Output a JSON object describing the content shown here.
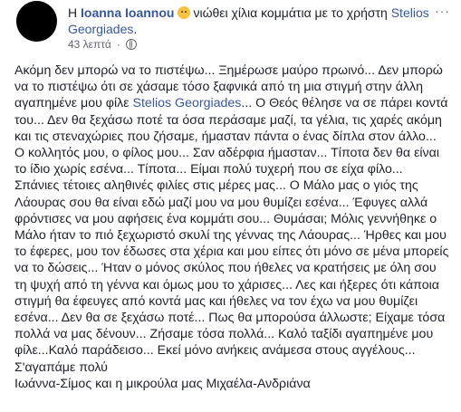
{
  "post": {
    "author": "Ioanna Ioannou",
    "prefix": "Η",
    "feeling_icon": "sad-face-emoji",
    "feeling_text": "νιώθει χίλια κομμάτια με το χρήστη",
    "tagged_user": "Stelios Georgiades",
    "tagged_suffix": ".",
    "time": "43 λεπτά",
    "separator": "·",
    "privacy_icon": "globe-icon",
    "more_label": "···",
    "body_part1": "Ακόμη δεν μπορώ να το πιστέψω... Ξημέρωσε μαύρο πρωινό... Δεν μπορώ να το πιστέψω ότι σε χάσαμε τόσο ξαφνικά από τη μια στιγμή στην άλλη αγαπημένε μου φίλε",
    "body_mention": "Stelios Georgiades",
    "body_part2": "... Ο Θεός θέλησε να σε πάρει κοντά του... Δεν θα ξεχάσω ποτέ τα όσα περάσαμε μαζί, τα γέλια, τις χαρές ακόμη και τις στεναχώριες που ζήσαμε, ήμασταν πάντα ο ένας δίπλα στον άλλο... Ο κολλητός μου, ο φίλος μου... Σαν αδέρφια ήμασταν... Τίποτα δεν θα είναι το ίδιο χωρίς εσένα... Τίποτα... Είμαι πολύ τυχερή που σε είχα φίλο... Σπάνιες τέτοιες αληθινές φιλίες στις μέρες μας... Ο Μάλο μας ο γιός της Λάουρας σου θα είναι εδώ μαζί μου να μου θυμίζει εσένα... Έφυγες αλλά φρόντισες να μου αφήσεις ένα κομμάτι σου... Θυμάσαι; Μόλις γεννήθηκε ο Μάλο ήταν το πιό ξεχωριστό σκυλί της γέννας της Λάουρας... Ήρθες και μου το έφερες, μου τον έδωσες στα χέρια και μου είπες ότι μόνο σε μένα μπορείς να το δώσεις... Ήταν ο μόνος σκύλος που ήθελες να κρατήσεις με όλη σου τη ψυχή από τη γέννα και όμως μου το χάρισες... Λες και ήξερες ότι κάποια στιγμή θα έφευγες από κοντά μας και ήθελες να τον έχω να μου θυμίζει εσένα... Δεν θα σε ξεχάσω ποτέ... Πως θα μπορούσα άλλωστε; Είχαμε τόσα πολλά να μας δένουν... Ζήσαμε τόσα πολλά... Καλό ταξίδι αγαπημένε μου φίλε...Καλό παράδεισο... Εκεί μόνο ανήκεις ανάμεσα στους αγγέλους...",
    "body_line2": "Σ'αγαπάμε πολύ",
    "body_line3": "Ιωάννα-Σίμος και η μικρούλα μας Μιχαέλα-Ανδριάνα"
  }
}
